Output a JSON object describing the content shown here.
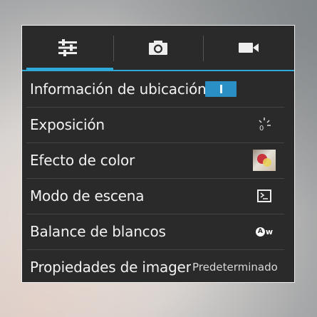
{
  "tabs": [
    {
      "icon": "sliders-icon",
      "active": true
    },
    {
      "icon": "camera-icon",
      "active": false
    },
    {
      "icon": "video-camera-icon",
      "active": false
    }
  ],
  "settings": [
    {
      "label": "Información de ubicación",
      "control": "toggle",
      "state": "on"
    },
    {
      "label": "Exposición",
      "icon": "exposure-icon",
      "value_text": "0"
    },
    {
      "label": "Efecto de color",
      "icon": "color-effect-thumbnail"
    },
    {
      "label": "Modo de escena",
      "icon": "scene-mode-icon"
    },
    {
      "label": "Balance de blancos",
      "icon": "white-balance-auto-icon",
      "badge_text": "A",
      "badge_suffix": "w"
    },
    {
      "label": "Propiedades de imagen",
      "value": "Predeterminado"
    }
  ],
  "colors": {
    "accent": "#2fa9d8",
    "panel": "#2a2a2a",
    "toggle_on": "#2a8fc4"
  }
}
